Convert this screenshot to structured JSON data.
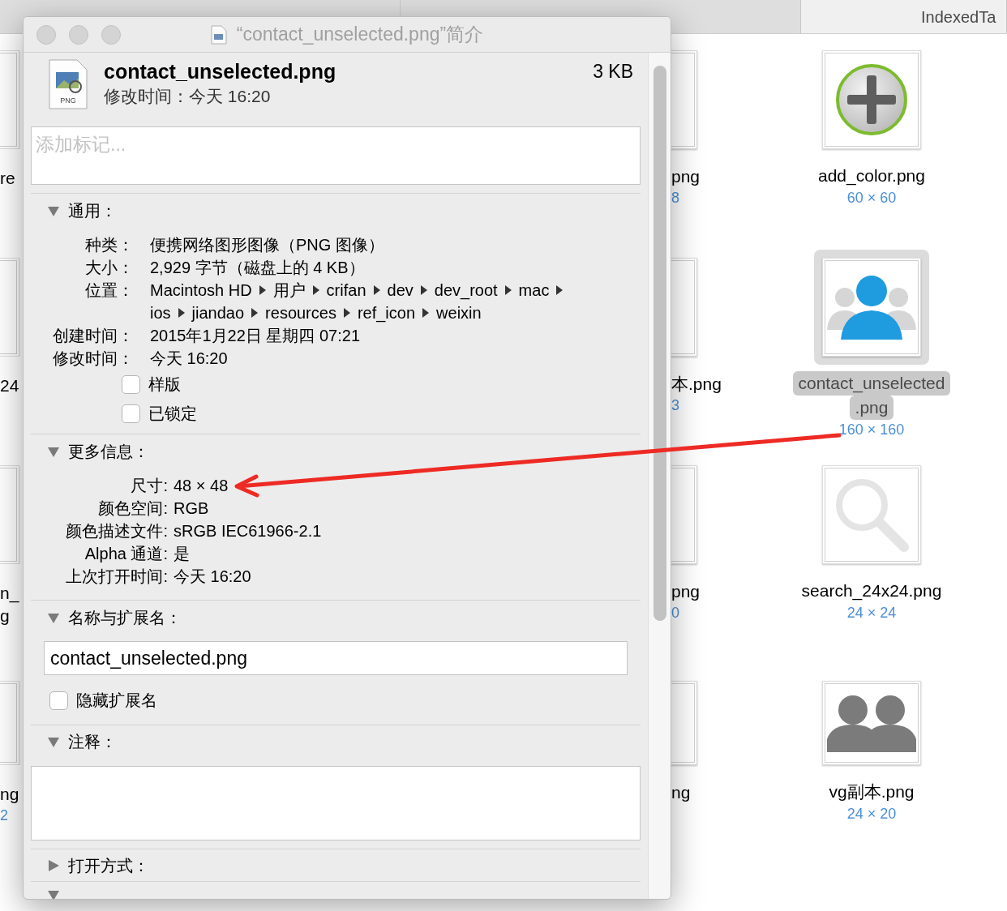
{
  "finder": {
    "tabs": [
      {
        "selected": false
      },
      {
        "selected": false
      },
      {
        "label": "IndexedTa",
        "selected": true
      }
    ],
    "left_column": [
      {
        "lines": [
          "re"
        ]
      },
      {
        "lines": [
          "24"
        ]
      },
      {
        "lines": [
          "n_",
          "g"
        ]
      },
      {
        "lines": [
          "ng"
        ],
        "dims": "2"
      }
    ],
    "middle_column": [
      {
        "name": "png",
        "dims": "8"
      },
      {
        "name": "本.png",
        "dims": "3"
      },
      {
        "name": "png",
        "dims": "0"
      },
      {
        "name": "ng"
      }
    ],
    "right_column": [
      {
        "kind": "add",
        "name_lines": [
          "add_color.png"
        ],
        "dims": "60 × 60",
        "selected": false
      },
      {
        "kind": "contacts",
        "name_lines": [
          "contact_unselected",
          ".png"
        ],
        "dims": "160 × 160",
        "selected": true
      },
      {
        "kind": "search",
        "name_lines": [
          "search_24x24.png"
        ],
        "dims": "24 × 24",
        "selected": false
      },
      {
        "kind": "group",
        "name_lines": [
          "vg副本.png"
        ],
        "dims": "24 × 20",
        "selected": false
      }
    ]
  },
  "inspector": {
    "title": "“contact_unselected.png”简介",
    "file_name": "contact_unselected.png",
    "file_type_label": "PNG",
    "size": "3 KB",
    "modified": "修改时间：今天 16:20",
    "tags_placeholder": "添加标记...",
    "sections": [
      {
        "kind": "general",
        "title": "通用：",
        "expanded": true,
        "rows": [
          {
            "label": "种类：",
            "value": "便携网络图形图像（PNG 图像）"
          },
          {
            "label": "大小：",
            "value": "2,929 字节（磁盘上的 4 KB）"
          },
          {
            "label": "位置：",
            "path_lines": [
              [
                "Macintosh HD",
                "用户",
                "crifan",
                "dev",
                "dev_root",
                "mac"
              ],
              [
                "ios",
                "jiandao",
                "resources",
                "ref_icon",
                "weixin"
              ]
            ]
          },
          {
            "label": "创建时间：",
            "value": "2015年1月22日 星期四 07:21"
          },
          {
            "label": "修改时间：",
            "value": "今天 16:20"
          }
        ],
        "checkboxes": [
          {
            "label": "样版",
            "checked": false
          },
          {
            "label": "已锁定",
            "checked": false
          }
        ]
      },
      {
        "kind": "more_info",
        "title": "更多信息：",
        "expanded": true,
        "rows": [
          {
            "label": "尺寸:",
            "value": "48 × 48"
          },
          {
            "label": "颜色空间:",
            "value": "RGB"
          },
          {
            "label": "颜色描述文件:",
            "value": "sRGB IEC61966-2.1"
          },
          {
            "label": "Alpha 通道:",
            "value": "是"
          },
          {
            "label": "上次打开时间:",
            "value": "今天 16:20"
          }
        ]
      },
      {
        "kind": "name",
        "title": "名称与扩展名：",
        "expanded": true,
        "value": "contact_unselected.png",
        "checkboxes": [
          {
            "label": "隐藏扩展名",
            "checked": false
          }
        ]
      },
      {
        "kind": "comments",
        "title": "注释：",
        "expanded": true
      },
      {
        "kind": "open_with",
        "title": "打开方式：",
        "expanded": false
      },
      {
        "kind": "preview",
        "expanded": true
      }
    ]
  }
}
